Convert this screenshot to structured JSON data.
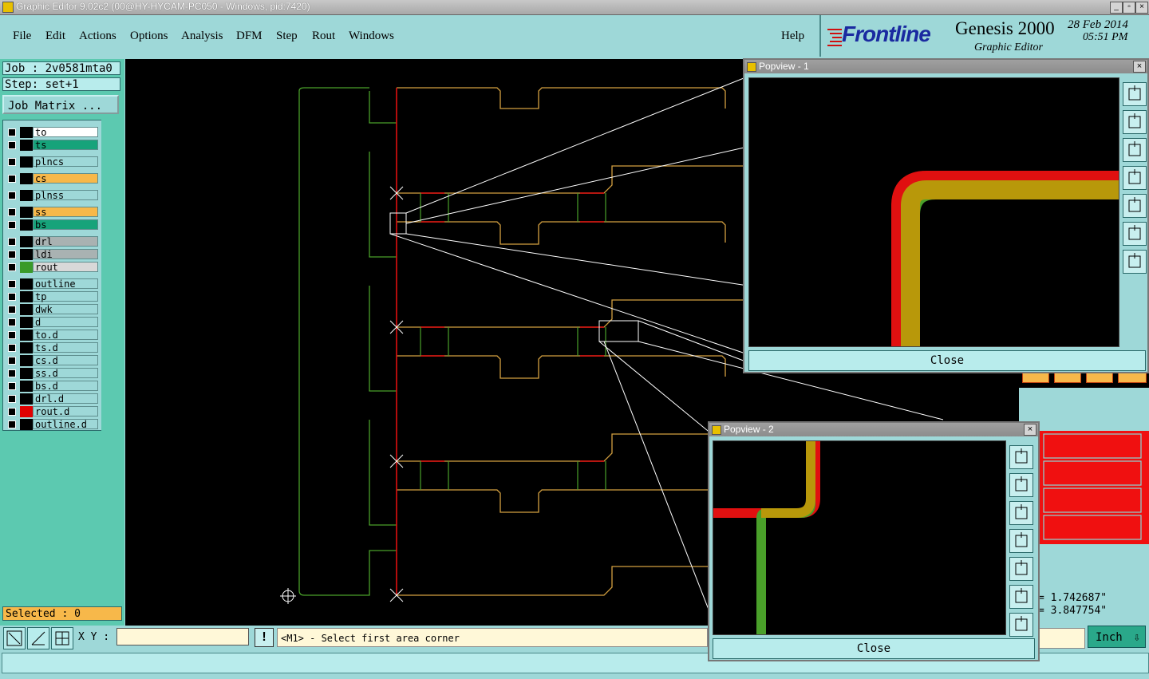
{
  "window": {
    "title": "Graphic Editor 9.02c2 (00@HY-HYCAM-PC050 - Windows, pid:7420)"
  },
  "menu": [
    "File",
    "Edit",
    "Actions",
    "Options",
    "Analysis",
    "DFM",
    "Step",
    "Rout",
    "Windows"
  ],
  "help": "Help",
  "brand": {
    "logo": "Frontline",
    "product": "Genesis 2000",
    "subtitle": "Graphic Editor",
    "date": "28 Feb 2014",
    "time": "05:51 PM"
  },
  "job": {
    "label": "Job : 2v0581mta0",
    "step": "Step: set+1",
    "matrix_button": "Job Matrix ..."
  },
  "layers": [
    {
      "name": "to",
      "color": "#ffffff",
      "swatch": "#000000"
    },
    {
      "name": "ts",
      "color": "#16a37a",
      "swatch": "#000000"
    },
    {
      "name": "plncs",
      "color": "#9ed8d8",
      "swatch": "#000000"
    },
    {
      "name": "cs",
      "color": "#f7b84a",
      "swatch": "#000000"
    },
    {
      "name": "plnss",
      "color": "#9ed8d8",
      "swatch": "#000000"
    },
    {
      "name": "ss",
      "color": "#f7b84a",
      "swatch": "#000000"
    },
    {
      "name": "bs",
      "color": "#16a37a",
      "swatch": "#000000"
    },
    {
      "name": "drl",
      "color": "#a9b2b2",
      "swatch": "#000000"
    },
    {
      "name": "ldi",
      "color": "#a9b2b2",
      "swatch": "#000000"
    },
    {
      "name": "rout",
      "color": "#d8d8d8",
      "swatch": "#3a9a2a"
    },
    {
      "name": "outline",
      "color": "#9ed8d8",
      "swatch": "#000000"
    },
    {
      "name": "tp",
      "color": "#9ed8d8",
      "swatch": "#000000"
    },
    {
      "name": "dwk",
      "color": "#9ed8d8",
      "swatch": "#000000"
    },
    {
      "name": "d",
      "color": "#9ed8d8",
      "swatch": "#000000"
    },
    {
      "name": "to.d",
      "color": "#9ed8d8",
      "swatch": "#000000"
    },
    {
      "name": "ts.d",
      "color": "#9ed8d8",
      "swatch": "#000000"
    },
    {
      "name": "cs.d",
      "color": "#9ed8d8",
      "swatch": "#000000"
    },
    {
      "name": "ss.d",
      "color": "#9ed8d8",
      "swatch": "#000000"
    },
    {
      "name": "bs.d",
      "color": "#9ed8d8",
      "swatch": "#000000"
    },
    {
      "name": "drl.d",
      "color": "#9ed8d8",
      "swatch": "#000000"
    },
    {
      "name": "rout.d",
      "color": "#9ed8d8",
      "swatch": "#e00000"
    },
    {
      "name": "outline.d",
      "color": "#9ed8d8",
      "swatch": "#000000"
    }
  ],
  "selected": "Selected : 0",
  "xy_label": "X Y :",
  "xy_value": "",
  "message": "<M1> - Select first area corner",
  "units": "Inch",
  "coords": {
    "x": "= 1.742687\"",
    "y": "= 3.847754\""
  },
  "popview1": {
    "title": "Popview - 1",
    "close": "Close"
  },
  "popview2": {
    "title": "Popview - 2",
    "close": "Close"
  }
}
